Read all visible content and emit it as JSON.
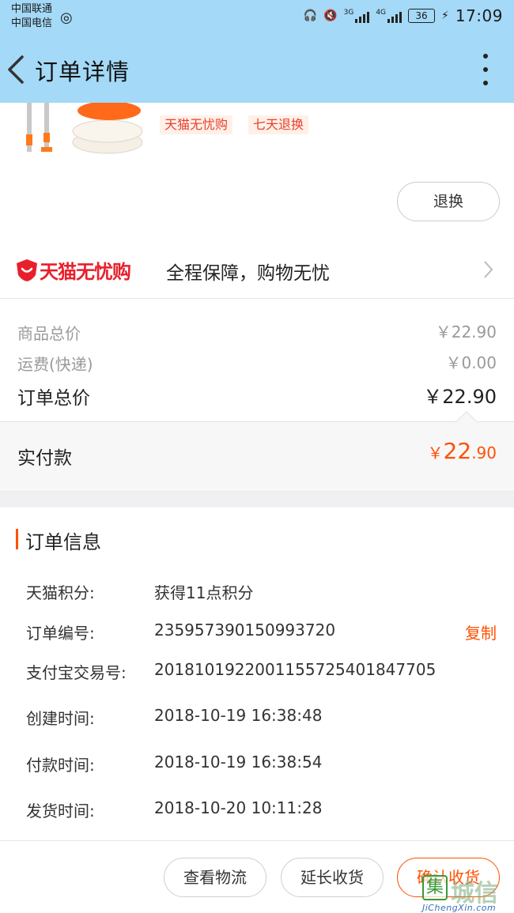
{
  "status_bar": {
    "carrier1": "中国联通",
    "carrier2": "中国电信",
    "net1": "3G",
    "net2": "4G",
    "battery": "36",
    "time": "17:09"
  },
  "header": {
    "title": "订单详情"
  },
  "product": {
    "tags": [
      "天猫无忧购",
      "七天退换"
    ],
    "refund_button": "退换"
  },
  "worry_free": {
    "brand": "天猫无忧购",
    "desc": "全程保障，购物无忧"
  },
  "prices": {
    "goods_total_label": "商品总价",
    "goods_total_value": "￥22.90",
    "shipping_label": "运费(快递)",
    "shipping_value": "￥0.00",
    "order_total_label": "订单总价",
    "order_total_value": "￥22.90",
    "paid_label": "实付款",
    "paid_currency": "￥",
    "paid_int": "22",
    "paid_dec": ".90"
  },
  "order_info": {
    "title": "订单信息",
    "rows": [
      {
        "label": "天猫积分:",
        "value": "获得11点积分"
      },
      {
        "label": "订单编号:",
        "value": "235957390150993720"
      },
      {
        "label": "支付宝交易号:",
        "value": "2018101922001155725401847705"
      },
      {
        "label": "创建时间:",
        "value": "2018-10-19 16:38:48"
      },
      {
        "label": "付款时间:",
        "value": "2018-10-19 16:38:54"
      },
      {
        "label": "发货时间:",
        "value": "2018-10-20 10:11:28"
      }
    ],
    "copy_button": "复制"
  },
  "actions": {
    "logistics": "查看物流",
    "extend": "延长收货",
    "confirm": "确认收货"
  },
  "watermark": {
    "box": "集",
    "name": "城信",
    "url": "JiChengXin.com"
  },
  "colors": {
    "header_bg": "#a4d9f7",
    "accent": "#ff5000",
    "tmall_red": "#e8202c"
  }
}
